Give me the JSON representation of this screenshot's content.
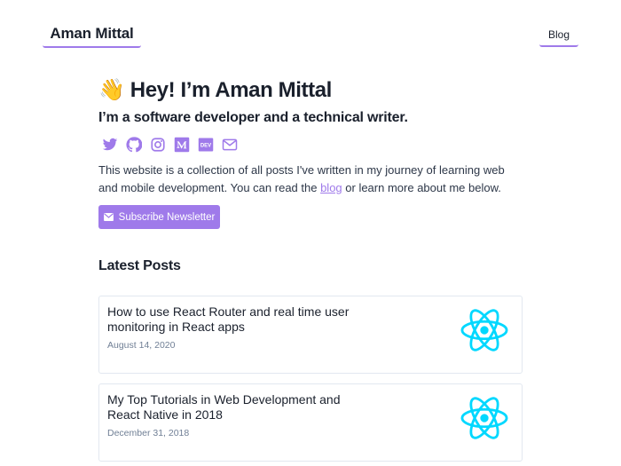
{
  "header": {
    "site_title": "Aman Mittal",
    "nav": {
      "blog": "Blog"
    }
  },
  "hero": {
    "emoji": "👋",
    "title": "Hey! I’m Aman Mittal",
    "subtitle": "I’m a software developer and a technical writer."
  },
  "socials": [
    {
      "name": "twitter-icon"
    },
    {
      "name": "github-icon"
    },
    {
      "name": "instagram-icon"
    },
    {
      "name": "medium-icon"
    },
    {
      "name": "dev-icon",
      "label": "DEV"
    },
    {
      "name": "email-icon"
    }
  ],
  "intro": {
    "text_before": "This website is a collection of all posts I've written in my journey of learning web and mobile development. You can read the ",
    "link_label": "blog",
    "text_after": " or learn more about me below."
  },
  "subscribe": {
    "label": "Subscribe Newsletter"
  },
  "latest_posts": {
    "title": "Latest Posts",
    "posts": [
      {
        "title": "How to use React Router and real time user monitoring in React apps",
        "date": "August 14, 2020"
      },
      {
        "title": "My Top Tutorials in Web Development and React Native in 2018",
        "date": "December 31, 2018"
      }
    ]
  },
  "colors": {
    "accent": "#9f7aea",
    "react": "#00d8ff",
    "text": "#1a202c"
  }
}
